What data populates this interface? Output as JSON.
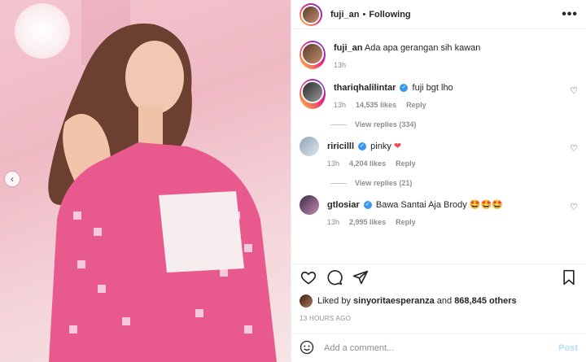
{
  "post": {
    "author": "fuji_an",
    "separator": "•",
    "follow_status": "Following",
    "more_label": "•••",
    "caption": "Ada apa gerangan sih kawan",
    "caption_time": "13h"
  },
  "comments": [
    {
      "user": "thariqhalilintar",
      "verified": true,
      "text": "fuji bgt lho",
      "time": "13h",
      "likes": "14,535 likes",
      "reply": "Reply",
      "view_replies": "View replies (334)"
    },
    {
      "user": "riricilll",
      "verified": true,
      "text": "pinky",
      "emoji": "❤",
      "time": "13h",
      "likes": "4,204 likes",
      "reply": "Reply",
      "view_replies": "View replies (21)"
    },
    {
      "user": "gtlosiar",
      "verified": true,
      "text": "Bawa Santai Aja Brody",
      "emoji": "🤩🤩🤩",
      "time": "13h",
      "likes": "2,995 likes",
      "reply": "Reply"
    }
  ],
  "likes": {
    "prefix": "Liked by",
    "user": "sinyoritaesperanza",
    "middle": "and",
    "count": "868,845 others"
  },
  "timestamp": "13 HOURS AGO",
  "add_comment": {
    "placeholder": "Add a comment...",
    "post_label": "Post"
  },
  "icons": {
    "prev": "chevron-left-icon",
    "more": "more-horizontal-icon",
    "like": "heart-icon",
    "comment": "comment-icon",
    "share": "send-icon",
    "save": "bookmark-icon",
    "emoji": "emoji-icon"
  },
  "colors": {
    "verified": "#3897f0",
    "heart": "#ed4956",
    "post_disabled": "#b2dffc",
    "secondary_text": "#8e8e8e"
  }
}
